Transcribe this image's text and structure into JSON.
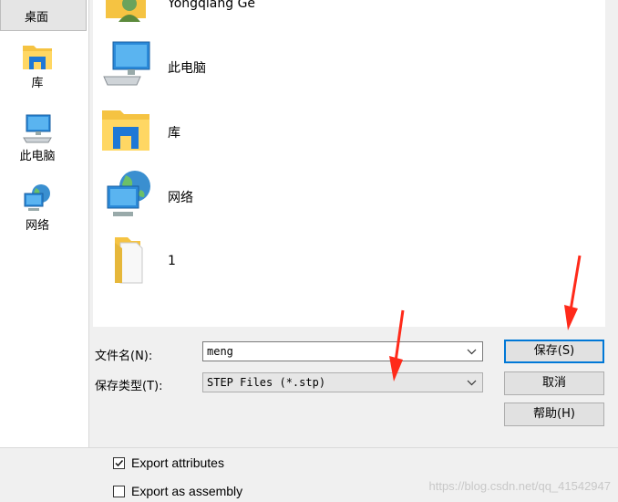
{
  "places": {
    "desktop": "桌面",
    "library": "库",
    "this_pc": "此电脑",
    "network": "网络"
  },
  "files": [
    {
      "name": "Yongqiang Ge",
      "icon": "user-folder-icon"
    },
    {
      "name": "此电脑",
      "icon": "computer-icon"
    },
    {
      "name": "库",
      "icon": "library-folder-icon"
    },
    {
      "name": "网络",
      "icon": "network-icon"
    },
    {
      "name": "1",
      "icon": "folder-icon"
    }
  ],
  "form": {
    "filename_label": "文件名(N):",
    "filename_value": "meng",
    "filetype_label": "保存类型(T):",
    "filetype_value": "STEP Files (*.stp)"
  },
  "buttons": {
    "save": "保存(S)",
    "cancel": "取消",
    "help": "帮助(H)"
  },
  "options": {
    "export_attributes": {
      "label": "Export attributes",
      "checked": true
    },
    "export_assembly": {
      "label": "Export as assembly",
      "checked": false
    }
  },
  "watermark": "https://blog.csdn.net/qq_41542947",
  "colors": {
    "accent": "#0078d7",
    "arrow": "#ff2a1a",
    "folder": "#f5c342"
  }
}
